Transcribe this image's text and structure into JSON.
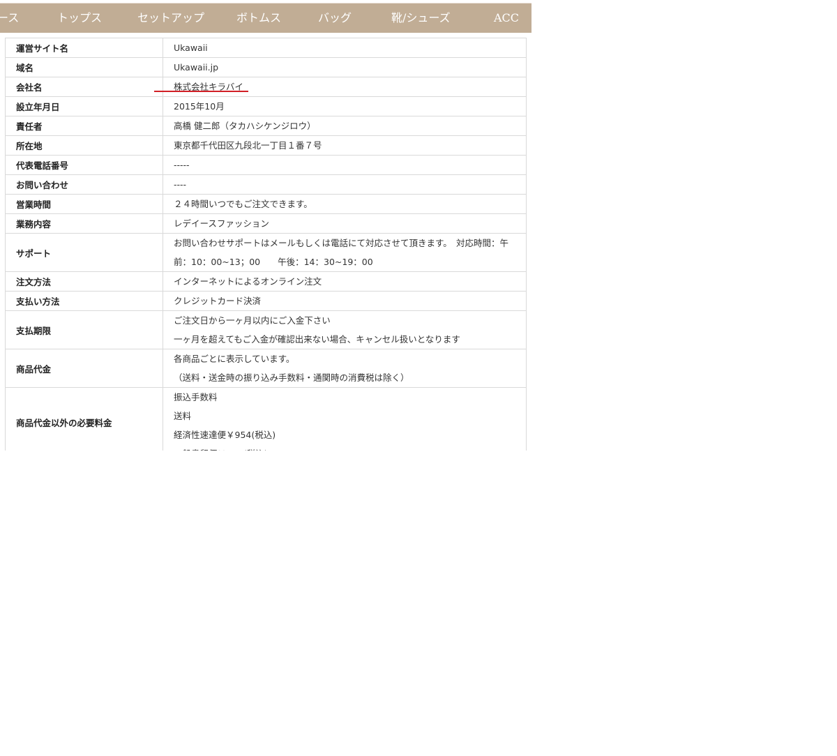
{
  "nav": {
    "items": [
      "ース",
      "トップス",
      "セットアップ",
      "ボトムス",
      "バッグ",
      "靴/シューズ",
      "ACC"
    ]
  },
  "table": {
    "rows": [
      {
        "label": "運営サイト名",
        "lines": [
          "Ukawaii"
        ]
      },
      {
        "label": "域名",
        "lines": [
          "Ukawaii.jp"
        ]
      },
      {
        "label": "会社名",
        "lines": [
          "株式会社キラバイ"
        ]
      },
      {
        "label": "設立年月日",
        "lines": [
          "2015年10月"
        ]
      },
      {
        "label": "責任者",
        "lines": [
          "高橋 健二郎（タカハシケンジロウ）"
        ]
      },
      {
        "label": "所在地",
        "lines": [
          "東京都千代田区九段北一丁目１番７号"
        ]
      },
      {
        "label": "代表電話番号",
        "lines": [
          "-----"
        ]
      },
      {
        "label": "お問い合わせ",
        "lines": [
          "----"
        ]
      },
      {
        "label": "営業時間",
        "lines": [
          "２４時間いつでもご注文できます。"
        ]
      },
      {
        "label": "業務内容",
        "lines": [
          "レデイースファッション"
        ]
      },
      {
        "label": "サポート",
        "lines": [
          "お問い合わせサポートはメールもしくは電話にて対応させて頂きます。　対応時間：午",
          "前：10：00~13；00　　午後：14：30~19：00"
        ]
      },
      {
        "label": "注文方法",
        "lines": [
          "インターネットによるオンライン注文"
        ]
      },
      {
        "label": "支払い方法",
        "lines": [
          "クレジットカード決済"
        ]
      },
      {
        "label": "支払期限",
        "lines": [
          "ご注文日から一ヶ月以内にご入金下さい",
          "一ヶ月を超えてもご入金が確認出来ない場合、キャンセル扱いとなります"
        ]
      },
      {
        "label": "商品代金",
        "lines": [
          "各商品ごとに表示しています。",
          "（送料・送金時の振り込み手数料・通関時の消費税は除く）"
        ]
      },
      {
        "label": "商品代金以外の必要料金",
        "lines": [
          "振込手数料",
          "送料",
          "経済性速達便￥954(税込)",
          "一般書留便￥　　(税込)"
        ]
      }
    ]
  },
  "colors": {
    "nav_background": "#c1ad95",
    "underline": "#d21f26",
    "border": "#d9d9d9"
  }
}
